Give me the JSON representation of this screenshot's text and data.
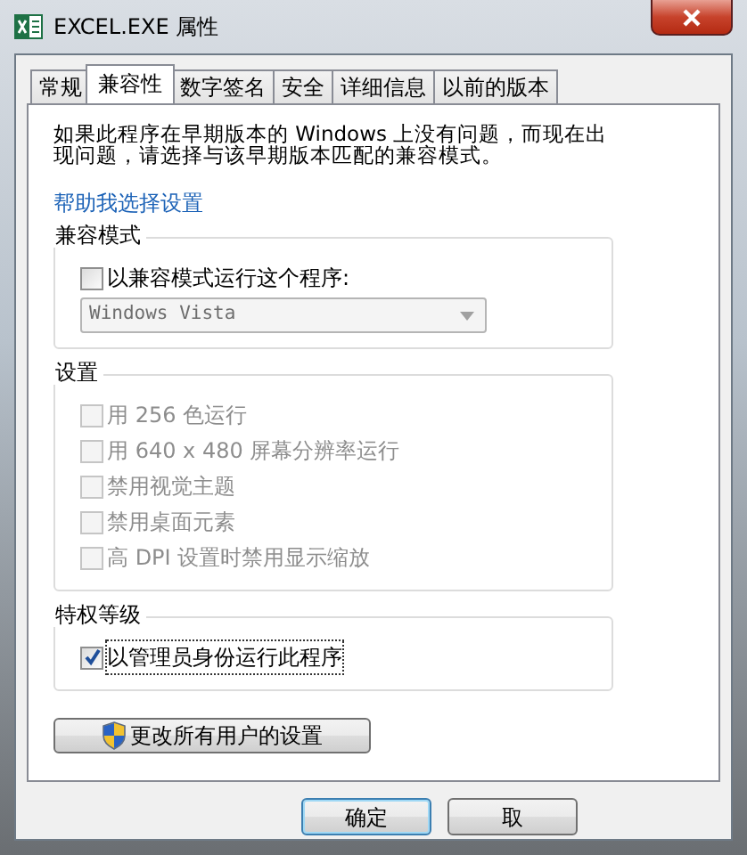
{
  "window": {
    "title": "EXCEL.EXE 属性"
  },
  "tabs": [
    {
      "label": "常规",
      "selected": false
    },
    {
      "label": "兼容性",
      "selected": true
    },
    {
      "label": "数字签名",
      "selected": false
    },
    {
      "label": "安全",
      "selected": false
    },
    {
      "label": "详细信息",
      "selected": false
    },
    {
      "label": "以前的版本",
      "selected": false
    }
  ],
  "intro": "如果此程序在早期版本的 Windows 上没有问题，而现在出现问题，请选择与该早期版本匹配的兼容模式。",
  "help_link": "帮助我选择设置",
  "groups": [
    {
      "title": "兼容模式",
      "options": [
        {
          "label": "以兼容模式运行这个程序:",
          "checked": false,
          "disabled": false
        }
      ],
      "dropdown": {
        "value": "Windows Vista",
        "disabled": true
      }
    },
    {
      "title": "设置",
      "options": [
        {
          "label": "用 256 色运行",
          "checked": false,
          "disabled": true
        },
        {
          "label": "用 640 x 480 屏幕分辨率运行",
          "checked": false,
          "disabled": true
        },
        {
          "label": "禁用视觉主题",
          "checked": false,
          "disabled": true
        },
        {
          "label": "禁用桌面元素",
          "checked": false,
          "disabled": true
        },
        {
          "label": "高 DPI 设置时禁用显示缩放",
          "checked": false,
          "disabled": true
        }
      ]
    },
    {
      "title": "特权等级",
      "options": [
        {
          "label": "以管理员身份运行此程序",
          "checked": true,
          "disabled": false
        }
      ]
    }
  ],
  "change_all_button": "更改所有用户的设置",
  "buttons": [
    {
      "label": "确定",
      "default": true
    },
    {
      "label": "取",
      "default": false
    }
  ]
}
